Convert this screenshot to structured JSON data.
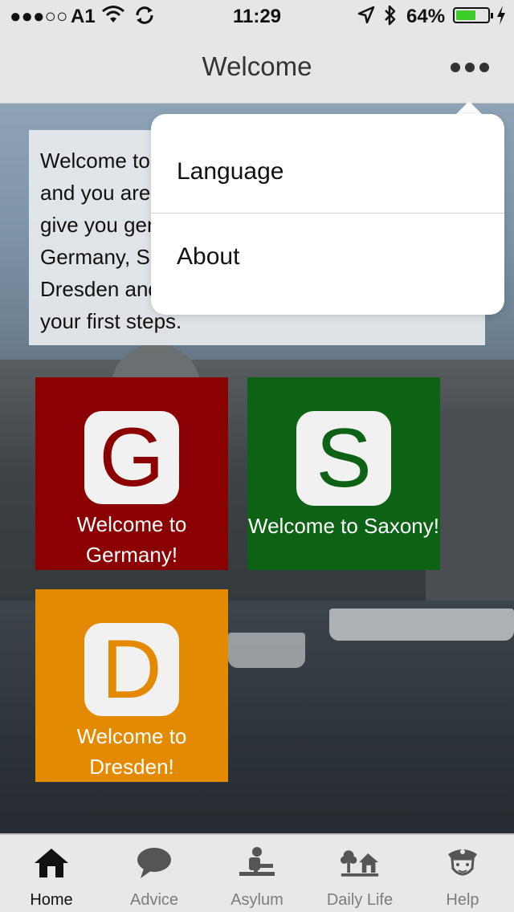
{
  "status_bar": {
    "signal": "●●●○○",
    "carrier": "A1",
    "time": "11:29",
    "battery_percent": "64%",
    "battery_level": 0.64
  },
  "nav": {
    "title": "Welcome"
  },
  "intro": {
    "text": "Welcome to Dresden! We are glad to have you and you are now using our welcome app. It will give you general information about life in Germany, Saxony and useful addresses in Dresden and things that might be useful for your first steps."
  },
  "tiles": [
    {
      "letter": "G",
      "label": "Welcome to Germany!",
      "color": "#8b0000"
    },
    {
      "letter": "S",
      "label": "Welcome to Saxony!",
      "color": "#0d6216"
    },
    {
      "letter": "D",
      "label": "Welcome to Dresden!",
      "color": "#e48a00"
    }
  ],
  "menu": {
    "items": [
      {
        "label": "Language"
      },
      {
        "label": "About"
      }
    ]
  },
  "tab_bar": {
    "active": "Home",
    "tabs": [
      {
        "label": "Home",
        "icon": "home-icon"
      },
      {
        "label": "Advice",
        "icon": "speech-bubble-icon"
      },
      {
        "label": "Asylum",
        "icon": "desk-person-icon"
      },
      {
        "label": "Daily Life",
        "icon": "tree-house-icon"
      },
      {
        "label": "Help",
        "icon": "police-officer-icon"
      }
    ]
  }
}
